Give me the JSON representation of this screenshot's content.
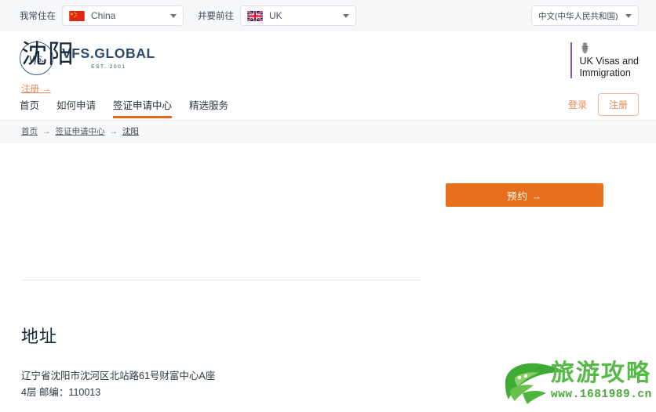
{
  "topbar": {
    "residence_label": "我常住在",
    "residence_value": "China",
    "residence_flag": "china-flag-icon",
    "destination_label": "并要前往",
    "destination_value": "UK",
    "destination_flag": "uk-flag-icon",
    "language_value": "中文(中华人民共和国)"
  },
  "brand": {
    "mark": "vfs.",
    "name": "VFS.GLOBAL",
    "established": "EST. 2001",
    "crest_line1": "UK Visas and",
    "crest_line2": "Immigration",
    "crest_accent": "#8f55a8"
  },
  "nav": {
    "items": [
      {
        "label": "首页",
        "active": false
      },
      {
        "label": "如何申请",
        "active": false
      },
      {
        "label": "签证申请中心",
        "active": true
      },
      {
        "label": "精选服务",
        "active": false
      }
    ],
    "login_label": "登录",
    "register_label": "注册",
    "active_color": "#e8671c",
    "link_color": "#e8885a"
  },
  "breadcrumb": {
    "items": [
      "首页",
      "签证申请中心",
      "沈阳"
    ],
    "separator": "→"
  },
  "main": {
    "page_title": "沈阳",
    "title_link": "注册 →",
    "cta_label": "预约 →",
    "cta_color": "#e8701c",
    "address_heading": "地址",
    "address_lines": [
      "辽宁省沈阳市沈河区北站路61号财富中心A座",
      "4层 邮编：110013"
    ]
  },
  "watermark": {
    "text": "旅游攻略",
    "url": "www.1681989.cn",
    "color": "#57b947"
  }
}
